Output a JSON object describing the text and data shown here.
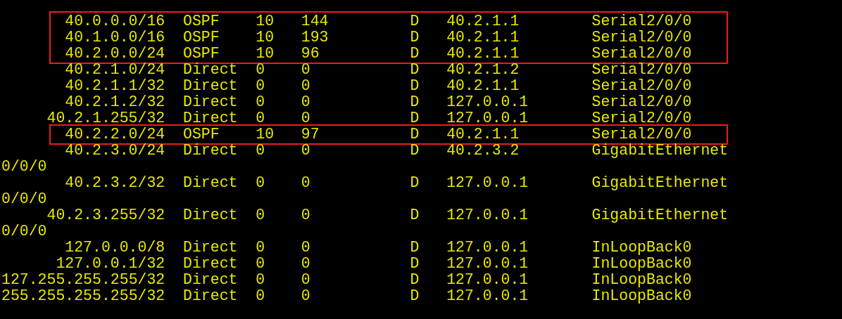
{
  "routes": [
    {
      "destination": "40.0.0.0/16",
      "proto": "OSPF",
      "pre": "10",
      "cost": "144",
      "flags": "D",
      "nexthop": "40.2.1.1",
      "interface": "Serial2/0/0",
      "highlighted": true
    },
    {
      "destination": "40.1.0.0/16",
      "proto": "OSPF",
      "pre": "10",
      "cost": "193",
      "flags": "D",
      "nexthop": "40.2.1.1",
      "interface": "Serial2/0/0",
      "highlighted": true
    },
    {
      "destination": "40.2.0.0/24",
      "proto": "OSPF",
      "pre": "10",
      "cost": "96",
      "flags": "D",
      "nexthop": "40.2.1.1",
      "interface": "Serial2/0/0",
      "highlighted": true
    },
    {
      "destination": "40.2.1.0/24",
      "proto": "Direct",
      "pre": "0",
      "cost": "0",
      "flags": "D",
      "nexthop": "40.2.1.2",
      "interface": "Serial2/0/0",
      "highlighted": false
    },
    {
      "destination": "40.2.1.1/32",
      "proto": "Direct",
      "pre": "0",
      "cost": "0",
      "flags": "D",
      "nexthop": "40.2.1.1",
      "interface": "Serial2/0/0",
      "highlighted": false
    },
    {
      "destination": "40.2.1.2/32",
      "proto": "Direct",
      "pre": "0",
      "cost": "0",
      "flags": "D",
      "nexthop": "127.0.0.1",
      "interface": "Serial2/0/0",
      "highlighted": false
    },
    {
      "destination": "40.2.1.255/32",
      "proto": "Direct",
      "pre": "0",
      "cost": "0",
      "flags": "D",
      "nexthop": "127.0.0.1",
      "interface": "Serial2/0/0",
      "highlighted": false
    },
    {
      "destination": "40.2.2.0/24",
      "proto": "OSPF",
      "pre": "10",
      "cost": "97",
      "flags": "D",
      "nexthop": "40.2.1.1",
      "interface": "Serial2/0/0",
      "highlighted": true
    },
    {
      "destination": "40.2.3.0/24",
      "proto": "Direct",
      "pre": "0",
      "cost": "0",
      "flags": "D",
      "nexthop": "40.2.3.2",
      "interface": "GigabitEthernet",
      "interface_wrapped": "0/0/0",
      "highlighted": false
    },
    {
      "destination": "40.2.3.2/32",
      "proto": "Direct",
      "pre": "0",
      "cost": "0",
      "flags": "D",
      "nexthop": "127.0.0.1",
      "interface": "GigabitEthernet",
      "interface_wrapped": "0/0/0",
      "highlighted": false
    },
    {
      "destination": "40.2.3.255/32",
      "proto": "Direct",
      "pre": "0",
      "cost": "0",
      "flags": "D",
      "nexthop": "127.0.0.1",
      "interface": "GigabitEthernet",
      "interface_wrapped": "0/0/0",
      "highlighted": false
    },
    {
      "destination": "127.0.0.0/8",
      "proto": "Direct",
      "pre": "0",
      "cost": "0",
      "flags": "D",
      "nexthop": "127.0.0.1",
      "interface": "InLoopBack0",
      "highlighted": false
    },
    {
      "destination": "127.0.0.1/32",
      "proto": "Direct",
      "pre": "0",
      "cost": "0",
      "flags": "D",
      "nexthop": "127.0.0.1",
      "interface": "InLoopBack0",
      "highlighted": false
    },
    {
      "destination": "127.255.255.255/32",
      "proto": "Direct",
      "pre": "0",
      "cost": "0",
      "flags": "D",
      "nexthop": "127.0.0.1",
      "interface": "InLoopBack0",
      "highlighted": false
    },
    {
      "destination": "255.255.255.255/32",
      "proto": "Direct",
      "pre": "0",
      "cost": "0",
      "flags": "D",
      "nexthop": "127.0.0.1",
      "interface": "InLoopBack0",
      "highlighted": false
    }
  ]
}
